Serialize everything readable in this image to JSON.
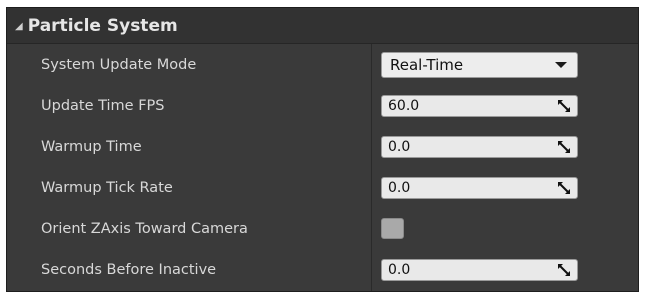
{
  "section": {
    "title": "Particle System",
    "collapse_icon": "triangle-down-icon"
  },
  "properties": [
    {
      "label": "System Update Mode",
      "type": "dropdown",
      "value": "Real-Time"
    },
    {
      "label": "Update Time FPS",
      "type": "number",
      "value": "60.0"
    },
    {
      "label": "Warmup Time",
      "type": "number",
      "value": "0.0"
    },
    {
      "label": "Warmup Tick Rate",
      "type": "number",
      "value": "0.0"
    },
    {
      "label": "Orient ZAxis Toward Camera",
      "type": "checkbox",
      "checked": false
    },
    {
      "label": "Seconds Before Inactive",
      "type": "number",
      "value": "0.0"
    }
  ]
}
